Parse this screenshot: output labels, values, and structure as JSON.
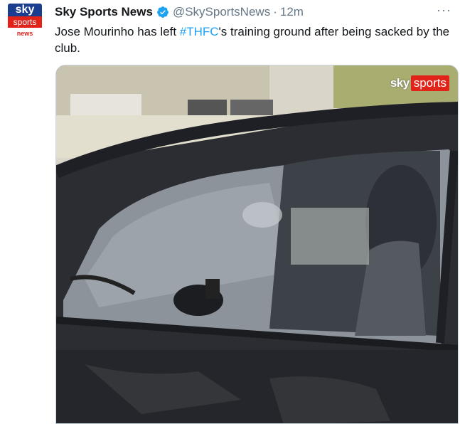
{
  "avatar": {
    "line1": "sky",
    "line2": "sports",
    "line3": "news"
  },
  "tweet": {
    "name": "Sky Sports News",
    "handle": "@SkySportsNews",
    "separator": "·",
    "time": "12m",
    "more": "···",
    "text_before": "Jose Mourinho has left ",
    "hashtag": "#THFC",
    "text_after": "'s training ground after being sacked by the club."
  },
  "media": {
    "watermark_sky": "sky",
    "watermark_sports": "sports"
  },
  "colors": {
    "link": "#1da1f2",
    "verified": "#1da1f2",
    "brand_red": "#e2231a",
    "brand_blue": "#1b3d8f"
  }
}
